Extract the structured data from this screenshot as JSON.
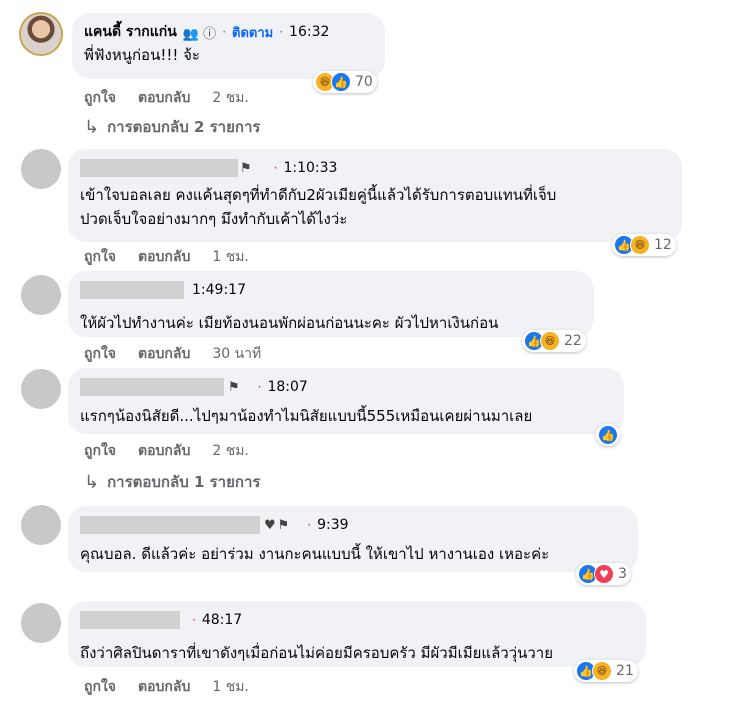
{
  "comments": [
    {
      "author": "แคนดี้ รากแก่น",
      "badge_icons": "👥 ⓘ",
      "follow": "ติดตาม",
      "time": "16:32",
      "text": "พี่ฟังหนูก่อน!!! จ้ะ",
      "reaction_count": "70",
      "like": "ถูกใจ",
      "reply": "ตอบกลับ",
      "age": "2 ชม.",
      "replies_link": "การตอบกลับ 2 รายการ"
    },
    {
      "time": "1:10:33",
      "text": "เข้าใจบอลเลย คงแค้นสุดๆที่ทำดีกับ2ผัวเมียคู่นี้แล้วได้รับการตอบแทนที่เจ็บ\nปวดเจ็บใจอย่างมากๆ มึงทำกับเค้าได้ไงว่ะ",
      "reaction_count": "12",
      "like": "ถูกใจ",
      "reply": "ตอบกลับ",
      "age": "1 ชม."
    },
    {
      "time": "1:49:17",
      "text": "ให้ผัวไปทำงานค่ะ เมียท้องนอนพักผ่อนก่อนนะคะ ผัวไปหาเงินก่อน",
      "reaction_count": "22",
      "like": "ถูกใจ",
      "reply": "ตอบกลับ",
      "age": "30 นาที"
    },
    {
      "time": "18:07",
      "text": "แรกๆน้องนิสัยดี...ไปๆมาน้องทำไมนิสัยแบบนี้555เหมือนเคยผ่านมาเลย",
      "like": "ถูกใจ",
      "reply": "ตอบกลับ",
      "age": "2 ชม.",
      "replies_link": "การตอบกลับ 1 รายการ"
    },
    {
      "time": "9:39",
      "text": "คุณบอล. ดีแล้วค่ะ อย่าร่วม งานกะคนแบบนี้ ให้เขาไป หางานเอง เหอะค่ะ",
      "reaction_count": "3"
    },
    {
      "time": "48:17",
      "text": "ถึงว่าศิลปินดาราที่เขาดังๆเมื่อก่อนไม่ค่อยมีครอบครัว มีผัวมีเมียแล้ววุ่นวาย",
      "reaction_count": "21",
      "like": "ถูกใจ",
      "reply": "ตอบกลับ",
      "age": "1 ชม."
    }
  ],
  "icons": {
    "flag": "⚑",
    "heart": "♥",
    "like": "👍",
    "haha": "😆",
    "love": "♥",
    "reply_arrow": "↳",
    "dot": "·"
  },
  "colors": {
    "accent": "#0866ff",
    "time_dot": "#e41e3f",
    "bubble": "#f0f2f5",
    "meta": "#65676b"
  }
}
